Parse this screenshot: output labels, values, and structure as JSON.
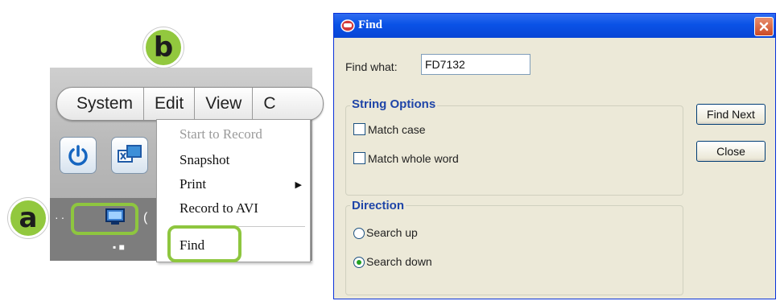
{
  "callouts": {
    "a": "a",
    "b": "b"
  },
  "menubar": {
    "items": [
      "System",
      "Edit",
      "View",
      "C"
    ]
  },
  "edit_menu": {
    "items": [
      {
        "label": "Start to Record",
        "enabled": false
      },
      {
        "label": "Snapshot",
        "enabled": true
      },
      {
        "label": "Print",
        "enabled": true,
        "submenu": true
      },
      {
        "label": "Record to AVI",
        "enabled": true
      },
      {
        "label": "Find",
        "enabled": true,
        "highlighted": true
      }
    ]
  },
  "device_tree": {
    "paren": "(",
    "sub": "▪ ■"
  },
  "find_dialog": {
    "title": "Find",
    "find_what_label": "Find what:",
    "find_what_value": "FD7132",
    "string_options": {
      "title": "String Options",
      "match_case": {
        "label": "Match case",
        "checked": false
      },
      "match_whole_word": {
        "label": "Match whole word",
        "checked": false
      }
    },
    "direction": {
      "title": "Direction",
      "search_up": {
        "label": "Search up",
        "selected": false
      },
      "search_down": {
        "label": "Search down",
        "selected": true
      }
    },
    "buttons": {
      "find_next": "Find Next",
      "close": "Close"
    }
  },
  "colors": {
    "callout_green": "#8ec63f",
    "xp_title_blue": "#0a52e6",
    "dialog_bg": "#ece9d8"
  },
  "icons": [
    "power-icon",
    "screens-icon",
    "computer-icon",
    "find-dialog-icon",
    "close-icon",
    "submenu-arrow-icon"
  ]
}
